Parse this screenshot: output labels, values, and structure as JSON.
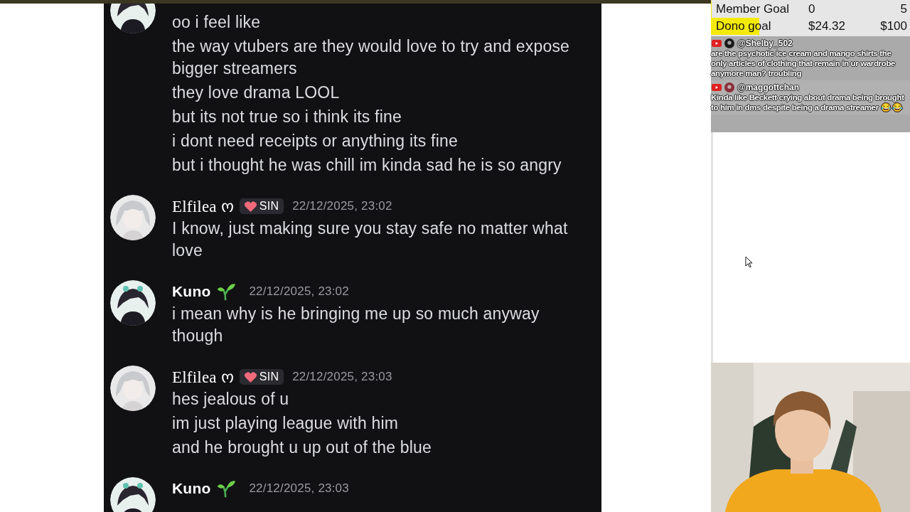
{
  "discord_chat": {
    "messages": [
      {
        "kind": "dark",
        "lines": [
          "oo i feel like",
          "the way vtubers are they would love to try and expose bigger streamers",
          "they love drama LOOL",
          "but its not true so i think its fine",
          "i dont need receipts or anything its fine",
          "but i thought he was chill im kinda sad he is so angry"
        ]
      },
      {
        "kind": "light",
        "author": "Elfilea ო",
        "tag": "SIN",
        "timestamp": "22/12/2025, 23:02",
        "lines": [
          "I know, just making sure you stay safe no matter what love"
        ]
      },
      {
        "kind": "dark",
        "author": "Kuno",
        "timestamp": "22/12/2025, 23:02",
        "lines": [
          "i mean why is he bringing me up so much anyway though"
        ]
      },
      {
        "kind": "light",
        "author": "Elfilea ო",
        "tag": "SIN",
        "timestamp": "22/12/2025, 23:03",
        "lines": [
          "hes jealous of u",
          "im just playing league with him",
          "and he brought u up out of the blue"
        ]
      },
      {
        "kind": "dark",
        "author": "Kuno",
        "timestamp": "22/12/2025, 23:03"
      }
    ]
  },
  "stream_overlay": {
    "goals": [
      {
        "label": "Member Goal",
        "current": "0",
        "target": "5",
        "level": 0
      },
      {
        "label": "Dono goal",
        "current": "$24.32",
        "target": "$100",
        "level": 0.2432
      }
    ],
    "live_chat": [
      {
        "username": "@Shelby_502",
        "message": "are the psychotic ice cream and mango shirts the only articles of clothing that remain in ur wardrobe anymore man? troubling"
      },
      {
        "username": "@maggottchan",
        "message": "Kinda like Beckett crying about drama being brought to him in dms despite being a drama streamer 😂 😂"
      }
    ]
  }
}
